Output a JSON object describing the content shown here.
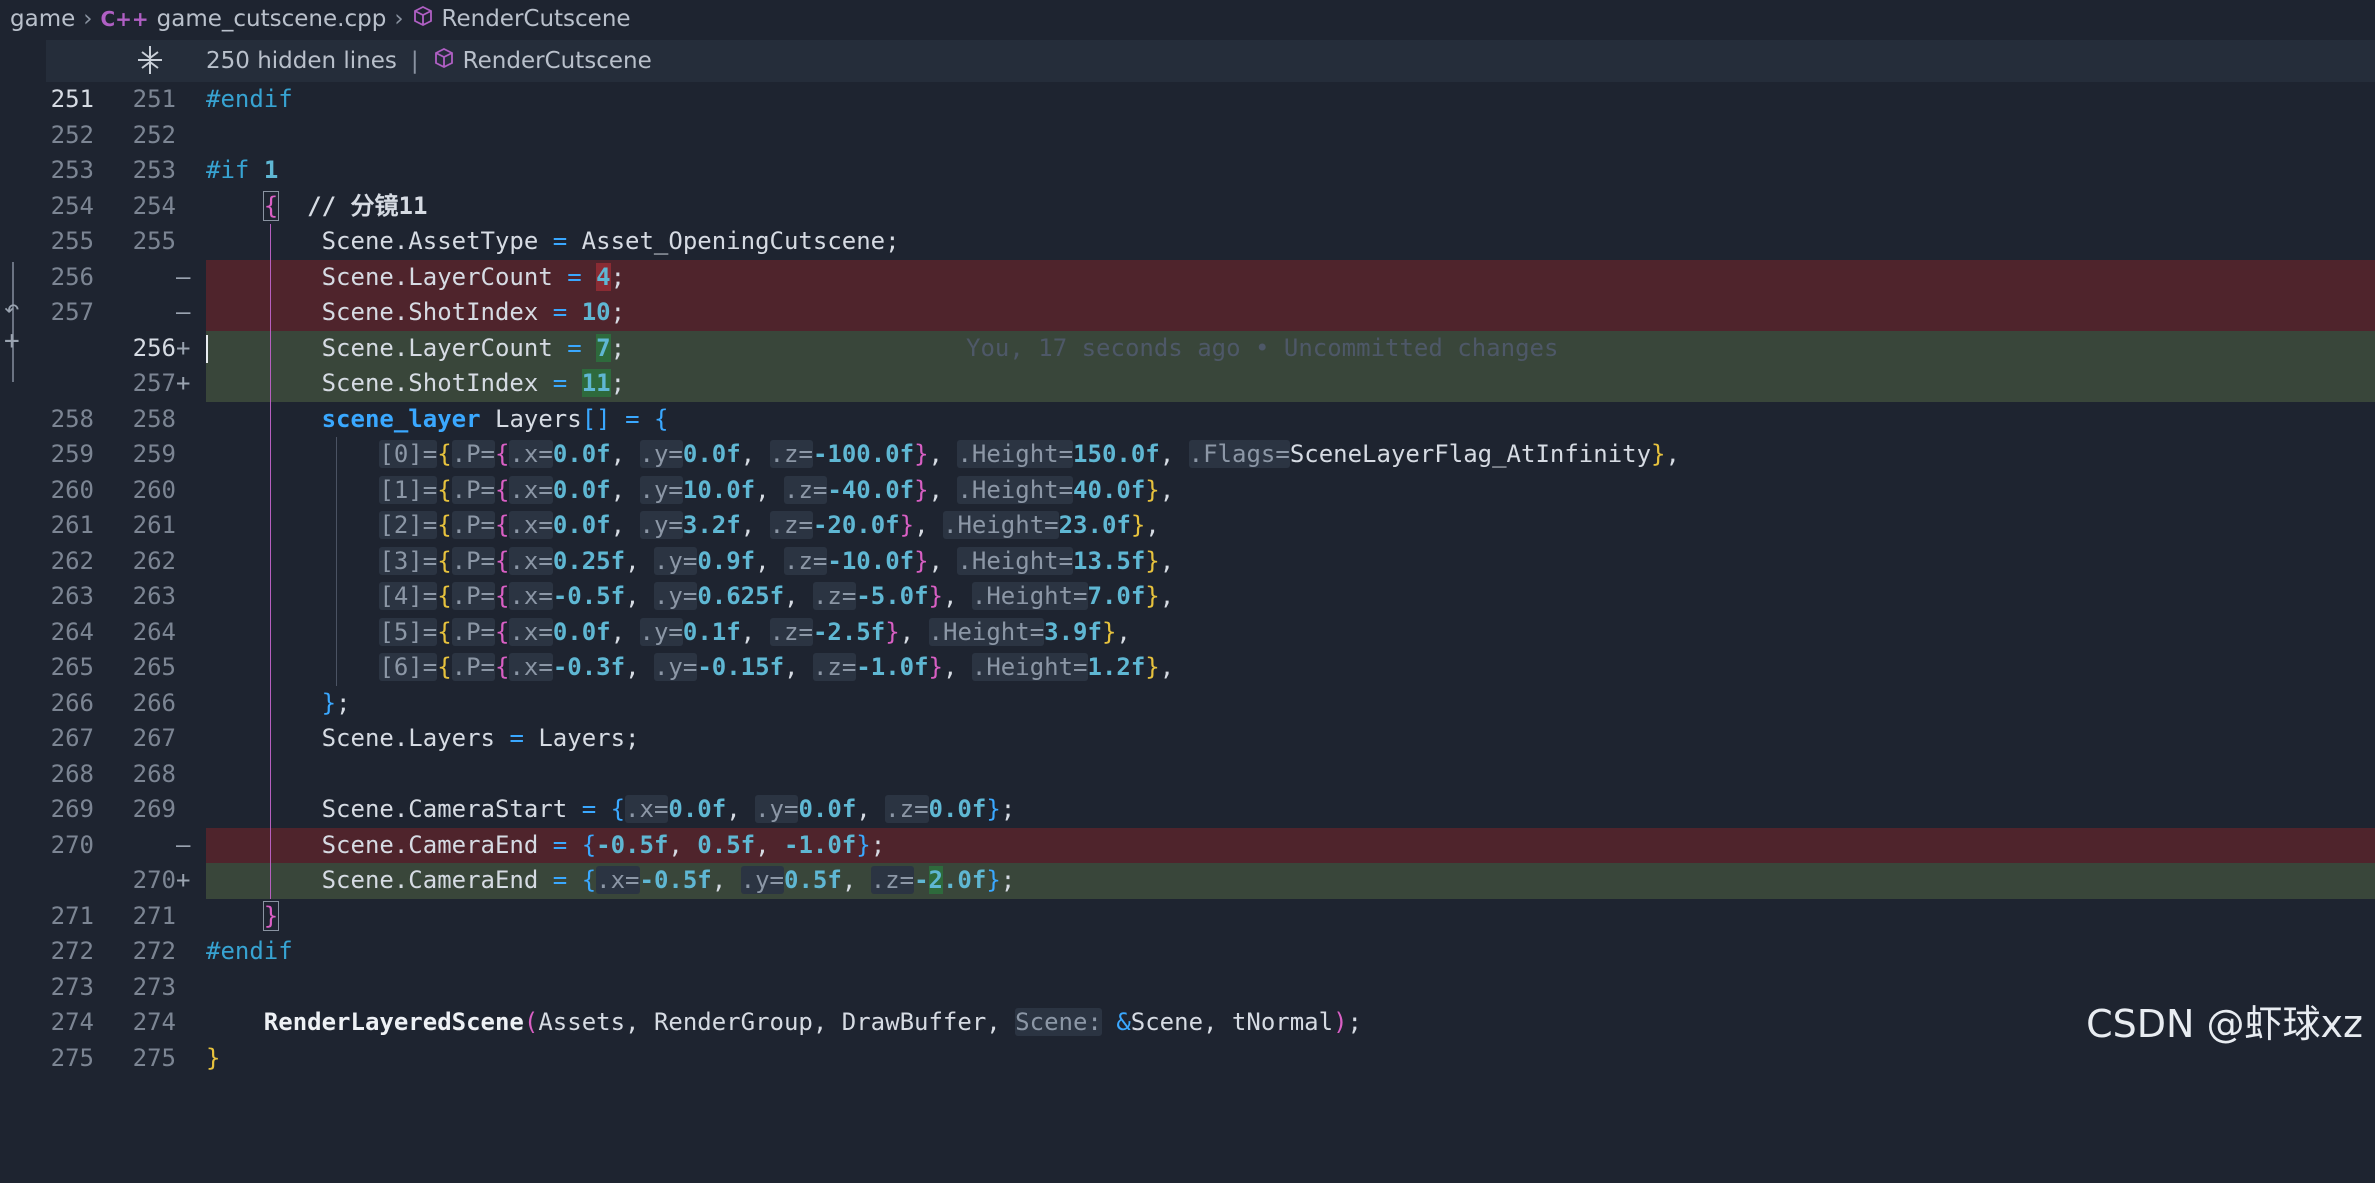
{
  "breadcrumb": {
    "folder": "game",
    "file": "game_cutscene.cpp",
    "file_icon": "C++",
    "symbol": "RenderCutscene"
  },
  "hidden_bar": {
    "label": "250 hidden lines",
    "symbol": "RenderCutscene"
  },
  "blame": "You, 17 seconds ago • Uncommitted changes",
  "watermark": "CSDN @虾球xz",
  "colors": {
    "deleted": "#4f242c",
    "added": "#39463a",
    "guide": "#b65fbf"
  }
}
